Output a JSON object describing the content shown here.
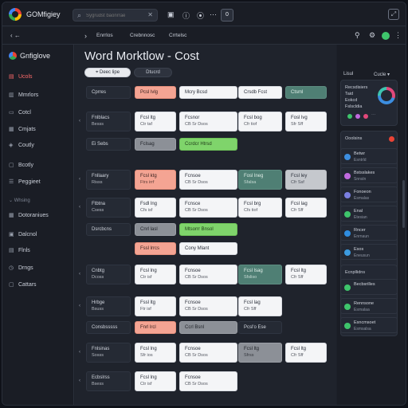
{
  "app": {
    "title": "GOMfigiey"
  },
  "search": {
    "placeholder": "Sygrudst baonrrae",
    "close": "✕"
  },
  "titlebar": {
    "box_label": "0"
  },
  "subbar": {
    "tabs": [
      "Enrrlos",
      "Crebnnosc",
      "Crrtelsc"
    ]
  },
  "sidebar": {
    "brand": "Gnfiglove",
    "items": [
      {
        "label": "Ucols",
        "active": true
      },
      {
        "label": "Mmrlors",
        "active": false
      },
      {
        "label": "Cotcl",
        "active": false
      },
      {
        "label": "Cmjats",
        "active": false
      },
      {
        "label": "Coutly",
        "active": false
      },
      {
        "label": "Bcotly",
        "active": false
      },
      {
        "label": "Peggieet",
        "active": false
      }
    ],
    "section": "Whsing",
    "items2": [
      {
        "label": "Dotoraniues"
      },
      {
        "label": "Dalcnol"
      },
      {
        "label": "Flnls"
      },
      {
        "label": "Drngs"
      },
      {
        "label": "Cattars"
      }
    ]
  },
  "main": {
    "title": "Word Morktlow - Cost",
    "pill_light": "Deec lipe",
    "pill_dark": "Dtucrd",
    "rows": [
      {
        "label": "Cprres",
        "cells": [
          {
            "l1": "Pcsl lvlg",
            "style": "salmon"
          },
          {
            "l1": "Mcry Bcsd",
            "style": "white"
          },
          {
            "l1": "Crsdb Fcst",
            "style": "white"
          },
          {
            "l1": "Ctsml",
            "style": "teal"
          }
        ]
      },
      {
        "label": "Fnlblacs",
        "sub": "Besss",
        "cells": [
          {
            "l1": "Fcsl ltg",
            "l2": "Ctr taf",
            "style": "white"
          },
          {
            "l1": "Fcsnor",
            "l2": "CB Sr Dsos",
            "style": "white"
          },
          {
            "l1": "Fcsl bog",
            "l2": "Cfr tiof",
            "style": "white"
          },
          {
            "l1": "Fosl lvg",
            "l2": "Sfr Sff",
            "style": "white"
          }
        ]
      },
      {
        "label": "Ei Sebs",
        "cells": [
          {
            "l1": "Fclsag",
            "style": "gray"
          },
          {
            "l1": "Ccrdcr Htrsd",
            "style": "green"
          }
        ]
      },
      {
        "label": "Fnllaary",
        "sub": "Risss",
        "cells": [
          {
            "l1": "Fcsl ktg",
            "l2": "Ftrs irrf",
            "style": "salmon"
          },
          {
            "l1": "Fcnsoe",
            "l2": "CB Sr Dsos",
            "style": "white"
          },
          {
            "l1": "Fosl lneg",
            "l2": "Sfalsa",
            "style": "teal"
          },
          {
            "l1": "Fcsl ley",
            "l2": "Cfr Ssf",
            "style": "lgray"
          }
        ]
      },
      {
        "label": "Ftbtna",
        "sub": "Csess",
        "cells": [
          {
            "l1": "Fsdl lng",
            "l2": "Cfs isf",
            "style": "white"
          },
          {
            "l1": "Fcnsce",
            "l2": "CB Sr Dsos",
            "style": "white"
          },
          {
            "l1": "Fcsl brg",
            "l2": "Cfs tiof",
            "style": "white"
          },
          {
            "l1": "Fcsl lag",
            "l2": "Cfr Sff",
            "style": "white"
          }
        ]
      },
      {
        "label": "Dsrcbcns",
        "cells": [
          {
            "l1": "Cnrl lasl",
            "style": "gray"
          },
          {
            "l1": "Mtsorrr Bnsol",
            "style": "green"
          }
        ]
      },
      {
        "label": "",
        "cells": [
          {
            "l1": "Fssl lrrcs",
            "style": "salmon"
          },
          {
            "l1": "Cony Mlant",
            "style": "white"
          }
        ]
      },
      {
        "label": "Cnbtg",
        "sub": "Dcoss",
        "cells": [
          {
            "l1": "Fcsl lng",
            "l2": "Ctr isf",
            "style": "white"
          },
          {
            "l1": "Fcnsoe",
            "l2": "CB Sr Dsos",
            "style": "white"
          },
          {
            "l1": "Fcsl lsag",
            "l2": "Sfsliso",
            "style": "teal"
          },
          {
            "l1": "Fcsl ltg",
            "l2": "Cfr Sff",
            "style": "white"
          }
        ]
      },
      {
        "label": "Hrbge",
        "sub": "Bsuss",
        "cells": [
          {
            "l1": "Fssl ltg",
            "l2": "Ftr isf",
            "style": "white"
          },
          {
            "l1": "Fcnsoe",
            "l2": "CB Sr Dsos",
            "style": "white"
          },
          {
            "l1": "Fcsl lag",
            "l2": "Cfr Sff",
            "style": "white"
          }
        ]
      },
      {
        "label": "Consbsssss",
        "cells": [
          {
            "l1": "Fnrl lrcl",
            "style": "salmon"
          },
          {
            "l1": "Ccrl Bsnl",
            "style": "gray"
          },
          {
            "l1": "Pcsl'o Ese",
            "style": "dark"
          }
        ]
      },
      {
        "label": "Fnlsinas",
        "sub": "Sosss",
        "cells": [
          {
            "l1": "Fcsl lng",
            "l2": "Sfr ios",
            "style": "white"
          },
          {
            "l1": "Fcnsoe",
            "l2": "CB Sr Dsos",
            "style": "white"
          },
          {
            "l1": "Fcsl ltg",
            "l2": "Sfrss",
            "style": "gray"
          },
          {
            "l1": "Fcsl ltg",
            "l2": "Cfr Sff",
            "style": "white"
          }
        ]
      },
      {
        "label": "Ecbslrss",
        "sub": "Bsess",
        "cells": [
          {
            "l1": "Fcsl lng",
            "l2": "Ctr isf",
            "style": "white"
          },
          {
            "l1": "Fcnsoe",
            "l2": "CB Sr Dsos",
            "style": "white"
          }
        ]
      }
    ]
  },
  "rpanel": {
    "head_left": "Lisul",
    "head_right": "Cucle",
    "summary": [
      "Recsdisiers",
      "Taid",
      "Eokcd",
      "Fslscldia"
    ],
    "feed_title": "Ooolsins",
    "feed": [
      {
        "t1": "Betwr",
        "t2": "Esntrld",
        "color": "#3c8ee0"
      },
      {
        "t1": "Bstsslakes",
        "t2": "Snnsln",
        "color": "#c06adf"
      },
      {
        "t1": "Fonoeon",
        "t2": "Esmalas",
        "color": "#7a7fe0"
      },
      {
        "t1": "Enal",
        "t2": "Etesian",
        "color": "#3ec46b"
      },
      {
        "t1": "Rncer",
        "t2": "Enrnaun",
        "color": "#2f8de0"
      },
      {
        "t1": "Esos",
        "t2": "Eneusun",
        "color": "#3c9be0"
      }
    ],
    "feed2_title": "Ecnpllidns",
    "feed2": [
      {
        "t1": "Becbsrilles",
        "t2": "",
        "color": "#3ec46b"
      },
      {
        "t1": "Rennsone",
        "t2": "Esrnalaa",
        "color": "#3ec46b"
      },
      {
        "t1": "Esncmsoet",
        "t2": "Esmsalsa",
        "color": "#3ec46b"
      }
    ]
  }
}
